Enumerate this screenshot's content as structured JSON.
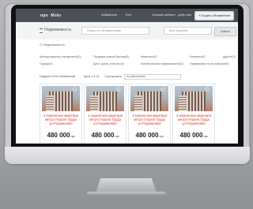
{
  "site": {
    "logo_main": "про",
    "logo_sub": "Mobr",
    "nav": [
      "Избранное",
      "Бел",
      "Личный кабинет",
      "Добр ино"
    ],
    "add_button": "+ Подать объявление"
  },
  "search": {
    "category": "Недвижимость",
    "query_placeholder": "Поиск по объявлениям",
    "region": "Вся Украина",
    "find_button": "Найти"
  },
  "breadcrumb": {
    "label": "Недвижимость"
  },
  "links": [
    "Аренда квартир (ежедневно)(0)",
    "Гаражи(0)",
    "Продажа комнат/Аренда(0)",
    "Дачи, дома, участки (0)",
    "Квартиры(0)",
    "Коммерческая недвижимость(0)",
    "Комнаты(0)",
    "Недвижимость за рубежом(0)",
    "Другое(0)"
  ],
  "sort": {
    "found": "Найдено 4034 объявлений",
    "price_range": "Цена 1 8 14",
    "sort_label": "Сортировать",
    "sort_value": "по умолчанию"
  },
  "cards": [
    {
      "title": "1-комнатная квартира метро Героев Труда ул.Родниковая",
      "price": "480 000",
      "currency": "грн"
    },
    {
      "title": "1-комнатная квартира метро Героев Труда ул.Родниковая",
      "price": "480 000",
      "currency": "грн"
    },
    {
      "title": "1-комнатная квартира метро Героев Труда ул.Родниковая",
      "price": "480 000",
      "currency": "грн"
    },
    {
      "title": "1-комнатная квартира метро Героев Труда ул.Родниковая",
      "price": "480 000",
      "currency": "грн"
    }
  ],
  "icons": {
    "apple": "apple-logo",
    "home": "home-icon",
    "star": "star-icon",
    "grid": "grid-icon"
  },
  "colors": {
    "topbar": "#4a4f58",
    "accent": "#d23b2f"
  }
}
